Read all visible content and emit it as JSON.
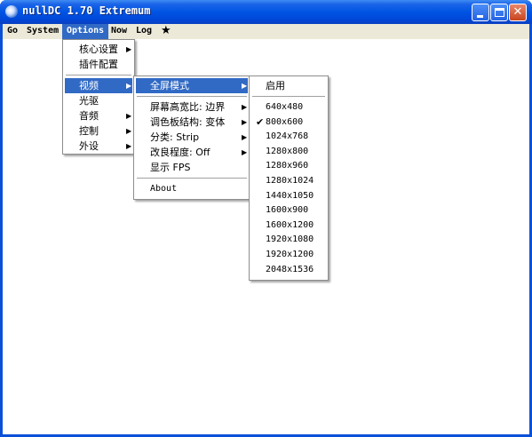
{
  "window": {
    "title": "nullDC 1.70 Extremum",
    "minimize_icon": "minimize-icon",
    "maximize_icon": "maximize-icon",
    "close_icon": "close-icon",
    "close_glyph": "✕"
  },
  "menubar": {
    "items": [
      {
        "label": "Go"
      },
      {
        "label": "System"
      },
      {
        "label": "Options"
      },
      {
        "label": "Now"
      },
      {
        "label": "Log"
      },
      {
        "label": "★"
      }
    ]
  },
  "options_menu": {
    "items": [
      {
        "label": "核心设置"
      },
      {
        "label": "插件配置"
      },
      {
        "label": "视频"
      },
      {
        "label": "光驱"
      },
      {
        "label": "音频"
      },
      {
        "label": "控制"
      },
      {
        "label": "外设"
      }
    ]
  },
  "video_menu": {
    "items": [
      {
        "label": "全屏模式"
      },
      {
        "label": "屏幕高宽比: 边界"
      },
      {
        "label": "调色板结构: 变体"
      },
      {
        "label": "分类: Strip"
      },
      {
        "label": "改良程度: Off"
      },
      {
        "label": "显示 FPS"
      },
      {
        "label": "About"
      }
    ]
  },
  "fullscreen_menu": {
    "enable_label": "启用",
    "checked_mark": "✔",
    "resolutions": [
      "640x480",
      "800x600",
      "1024x768",
      "1280x800",
      "1280x960",
      "1280x1024",
      "1440x1050",
      "1600x900",
      "1600x1200",
      "1920x1080",
      "1920x1200",
      "2048x1536"
    ],
    "selected_resolution": "800x600"
  },
  "colors": {
    "titlebar": "#0054e3",
    "menubar": "#ece9d8",
    "highlight": "#316ac5",
    "close_button": "#c7451f"
  }
}
